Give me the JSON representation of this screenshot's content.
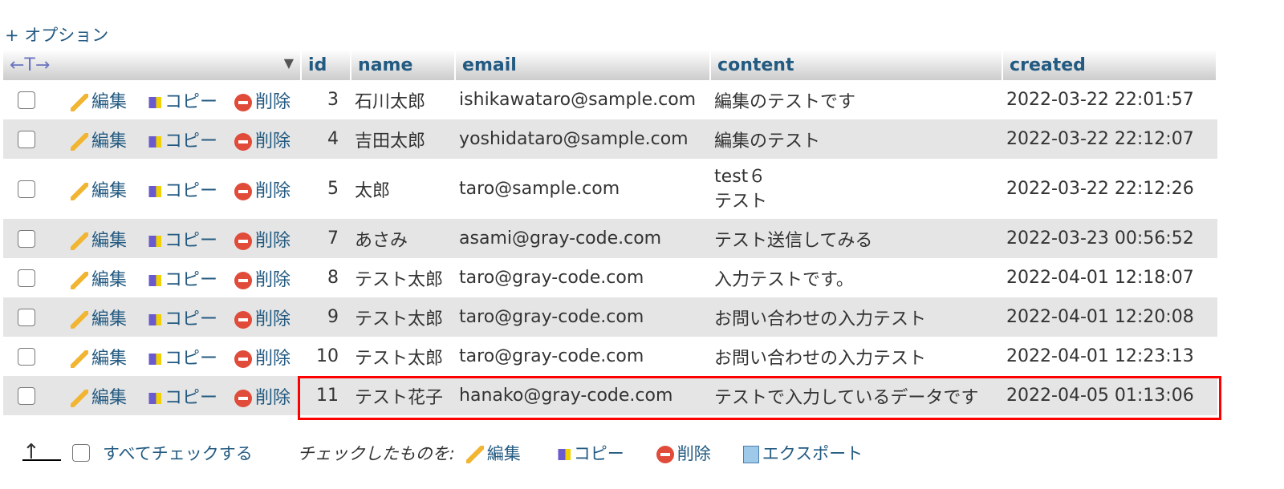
{
  "options_label": "+ オプション",
  "header": {
    "sort_icon": "←T→",
    "columns": [
      "id",
      "name",
      "email",
      "content",
      "created"
    ]
  },
  "row_actions": {
    "edit": "編集",
    "copy": "コピー",
    "delete": "削除"
  },
  "rows": [
    {
      "id": "3",
      "name": "石川太郎",
      "email": "ishikawataro@sample.com",
      "content": "編集のテストです",
      "content2": "",
      "created": "2022-03-22 22:01:57"
    },
    {
      "id": "4",
      "name": "吉田太郎",
      "email": "yoshidataro@sample.com",
      "content": "編集のテスト",
      "content2": "",
      "created": "2022-03-22 22:12:07"
    },
    {
      "id": "5",
      "name": "太郎",
      "email": "taro@sample.com",
      "content": "test６",
      "content2": "テスト",
      "created": "2022-03-22 22:12:26"
    },
    {
      "id": "7",
      "name": "あさみ",
      "email": "asami@gray-code.com",
      "content": "テスト送信してみる",
      "content2": "",
      "created": "2022-03-23 00:56:52"
    },
    {
      "id": "8",
      "name": "テスト太郎",
      "email": "taro@gray-code.com",
      "content": "入力テストです。",
      "content2": "",
      "created": "2022-04-01 12:18:07"
    },
    {
      "id": "9",
      "name": "テスト太郎",
      "email": "taro@gray-code.com",
      "content": "お問い合わせの入力テスト",
      "content2": "",
      "created": "2022-04-01 12:20:08"
    },
    {
      "id": "10",
      "name": "テスト太郎",
      "email": "taro@gray-code.com",
      "content": "お問い合わせの入力テスト",
      "content2": "",
      "created": "2022-04-01 12:23:13"
    },
    {
      "id": "11",
      "name": "テスト花子",
      "email": "hanako@gray-code.com",
      "content": "テストで入力しているデータです",
      "content2": "",
      "created": "2022-04-05 01:13:06"
    }
  ],
  "footer": {
    "check_all": "すべてチェックする",
    "with_selected": "チェックしたものを:",
    "edit": "編集",
    "copy": "コピー",
    "delete": "削除",
    "export": "エクスポート"
  },
  "highlight_color": "#ff0000"
}
